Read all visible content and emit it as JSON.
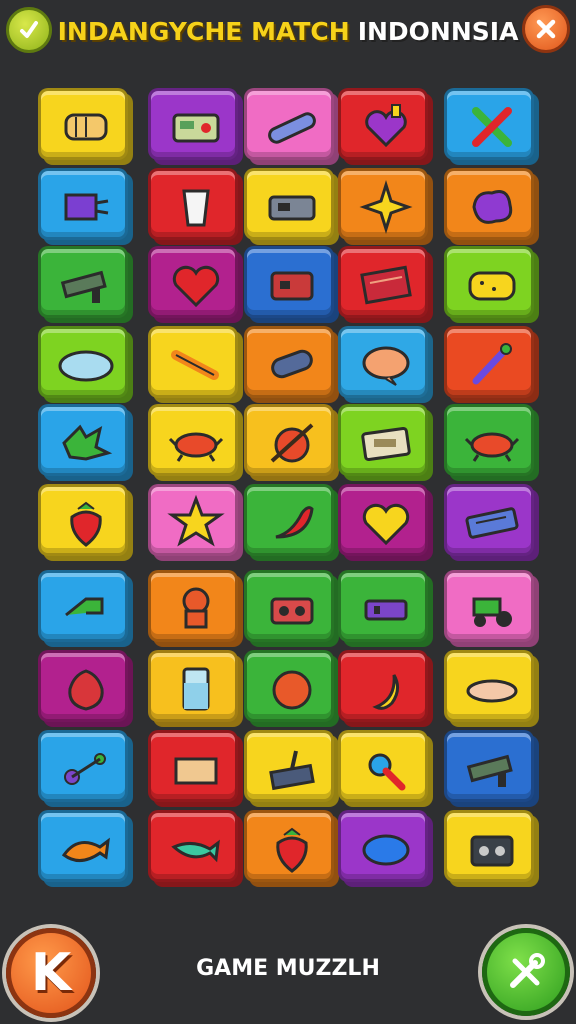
{
  "header": {
    "title_yellow": "INDANGYCHE MATCH",
    "title_white": "INDONNSIA",
    "back_icon": "check-back-icon",
    "close_icon": "close-icon"
  },
  "footer": {
    "left_button_label": "K",
    "label": "GAME MUZZLH",
    "right_button_icon": "tool-icon"
  },
  "board": {
    "rows": [
      [
        {
          "color": "#f7d51e",
          "icon": "bread"
        },
        {
          "color": "#9b36c9",
          "icon": "radio"
        },
        {
          "color": "#f06cc4",
          "icon": "tube"
        },
        {
          "color": "#e0262b",
          "icon": "heart-potion"
        },
        {
          "color": "#2aa4e8",
          "icon": "crossed-tools"
        }
      ],
      [
        {
          "color": "#2aa4e8",
          "icon": "robot"
        },
        {
          "color": "#e0262b",
          "icon": "cup"
        },
        {
          "color": "#f7d51e",
          "icon": "switch"
        },
        {
          "color": "#f2861a",
          "icon": "star-burst"
        },
        {
          "color": "#f2861a",
          "icon": "splat"
        }
      ],
      [
        {
          "color": "#3bb43a",
          "icon": "blaster"
        },
        {
          "color": "#b2218e",
          "icon": "heart"
        },
        {
          "color": "#2b6fd1",
          "icon": "box"
        },
        {
          "color": "#e0262b",
          "icon": "book"
        },
        {
          "color": "#7ed321",
          "icon": "sponge"
        }
      ],
      [
        {
          "color": "#7ed321",
          "icon": "oval"
        },
        {
          "color": "#f7d51e",
          "icon": "stick"
        },
        {
          "color": "#f2861a",
          "icon": "roller"
        },
        {
          "color": "#2fa8e6",
          "icon": "bubble"
        },
        {
          "color": "#ea4a22",
          "icon": "wand"
        }
      ],
      [
        {
          "color": "#2aa4e8",
          "icon": "leaf"
        },
        {
          "color": "#f7d51e",
          "icon": "crab"
        },
        {
          "color": "#f7c01e",
          "icon": "ball-slash"
        },
        {
          "color": "#7ed321",
          "icon": "cash"
        },
        {
          "color": "#3bb43a",
          "icon": "crab"
        }
      ],
      [
        {
          "color": "#f7d51e",
          "icon": "strawberry"
        },
        {
          "color": "#f06cc4",
          "icon": "star"
        },
        {
          "color": "#3bb43a",
          "icon": "chili"
        },
        {
          "color": "#b2218e",
          "icon": "heart-yellow"
        },
        {
          "color": "#9b36c9",
          "icon": "keyboard"
        }
      ],
      [
        {
          "color": "#2aa4e8",
          "icon": "pipe"
        },
        {
          "color": "#f2861a",
          "icon": "chef"
        },
        {
          "color": "#3bb43a",
          "icon": "radio-red"
        },
        {
          "color": "#3bb43a",
          "icon": "switch-purple"
        },
        {
          "color": "#f06cc4",
          "icon": "tractor"
        }
      ],
      [
        {
          "color": "#b2218e",
          "icon": "onion"
        },
        {
          "color": "#f7c01e",
          "icon": "glass"
        },
        {
          "color": "#3bb43a",
          "icon": "orange"
        },
        {
          "color": "#e0262b",
          "icon": "banana"
        },
        {
          "color": "#f7d51e",
          "icon": "plate"
        }
      ],
      [
        {
          "color": "#2aa4e8",
          "icon": "molecule"
        },
        {
          "color": "#e0262b",
          "icon": "box-flat"
        },
        {
          "color": "#f7d51e",
          "icon": "joystick"
        },
        {
          "color": "#f7d51e",
          "icon": "rattle"
        },
        {
          "color": "#2b6fd1",
          "icon": "blaster"
        }
      ],
      [
        {
          "color": "#2aa4e8",
          "icon": "fish"
        },
        {
          "color": "#e0262b",
          "icon": "fish-green"
        },
        {
          "color": "#f2861a",
          "icon": "strawberry"
        },
        {
          "color": "#9b36c9",
          "icon": "heart-blue"
        },
        {
          "color": "#f7d51e",
          "icon": "radio-dark"
        }
      ]
    ]
  }
}
